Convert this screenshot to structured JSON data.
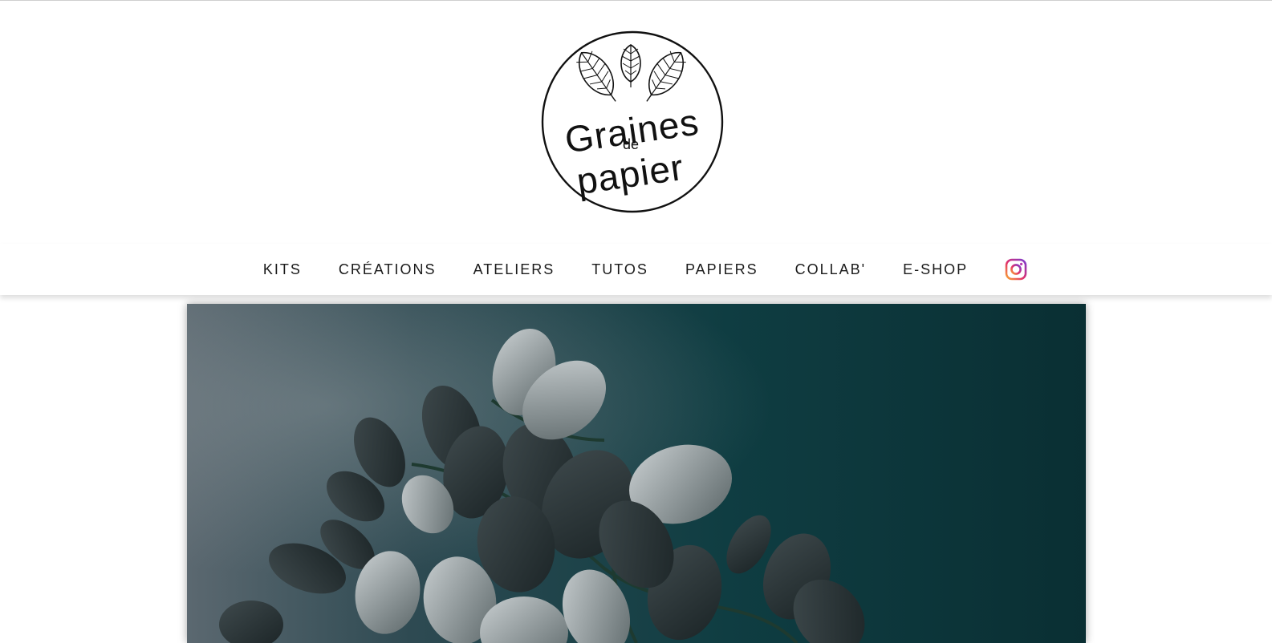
{
  "site": {
    "logo": {
      "line1": "Graines",
      "line2": "de",
      "line3": "papier",
      "icon": "leaves-logo-icon"
    }
  },
  "nav": {
    "items": [
      {
        "label": "KITS"
      },
      {
        "label": "CRÉATIONS"
      },
      {
        "label": "ATELIERS"
      },
      {
        "label": "TUTOS"
      },
      {
        "label": "PAPIERS"
      },
      {
        "label": "COLLAB'"
      },
      {
        "label": "E-SHOP"
      }
    ],
    "social_icon": "instagram-icon"
  },
  "hero": {
    "image": "eucalyptus-paper-leaves-photo"
  },
  "colors": {
    "background": "#ffffff",
    "nav_text": "#1a1a1a",
    "hero_teal": "#0e3b3f"
  }
}
